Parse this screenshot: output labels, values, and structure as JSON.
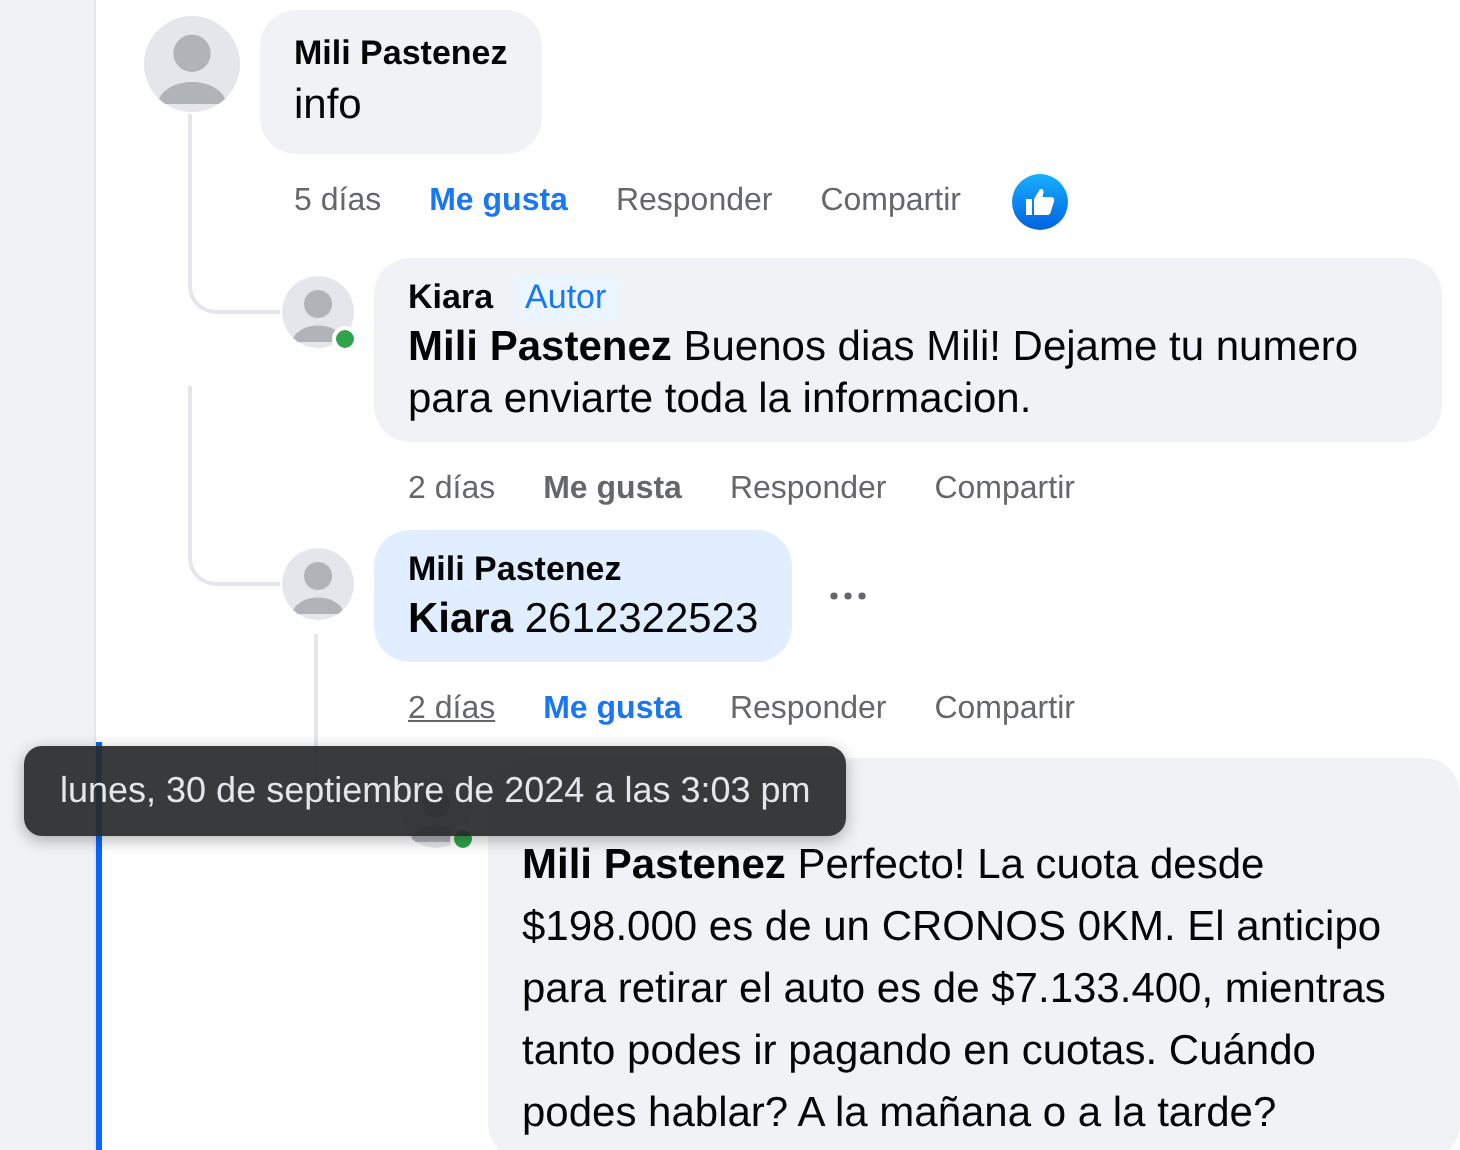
{
  "comments": [
    {
      "author": "Mili Pastenez",
      "text": "info",
      "time": "5 días",
      "time_hovered": false,
      "liked": true,
      "actions": [
        "Me gusta",
        "Responder",
        "Compartir"
      ],
      "reacted": true,
      "children": [
        {
          "author": "Kiara",
          "badge": "Autor",
          "text": "**Mili Pastenez** Buenos dias Mili! Dejame tu numero para enviarte toda la informacion.",
          "online": true,
          "time": "2 días",
          "time_hovered": false,
          "liked": false,
          "actions": [
            "Me gusta",
            "Responder",
            "Compartir"
          ]
        },
        {
          "author": "Mili Pastenez",
          "text": "**Kiara** 2612322523",
          "highlighted": true,
          "menu_visible": true,
          "time": "2 días",
          "time_hovered": true,
          "liked": true,
          "actions": [
            "Me gusta",
            "Responder",
            "Compartir"
          ],
          "children": [
            {
              "text": "**Mili Pastenez** Perfecto! La cuota desde $198.000 es de un CRONOS 0KM. El anticipo para retirar el auto es de $7.133.400, mientras tanto podes ir pagando en cuotas. Cuándo podes hablar? A la mañana o a la tarde?",
              "online": true,
              "focused": true
            }
          ]
        }
      ]
    }
  ],
  "tooltip": {
    "text": "lunes, 30 de septiembre de 2024 a las 3:03 pm"
  }
}
